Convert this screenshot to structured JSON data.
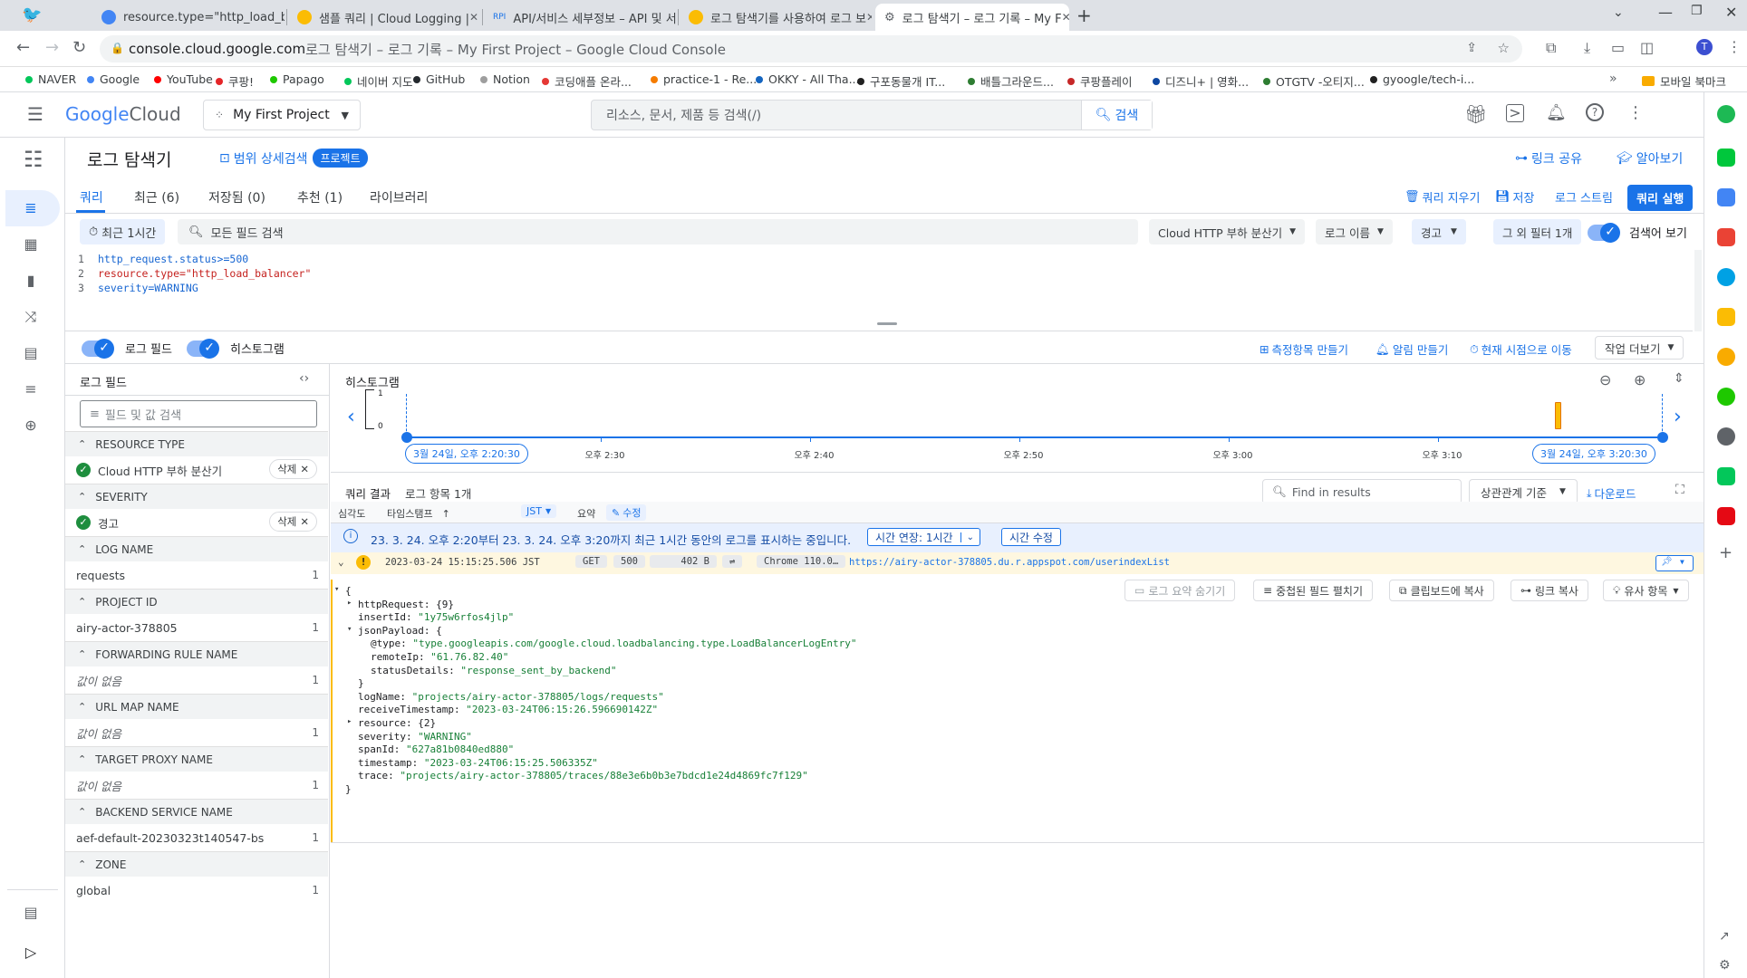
{
  "browser": {
    "tabs": [
      {
        "title": "resource.type=\"http_load_balan",
        "color": "#4285f4"
      },
      {
        "title": "샘플 쿼리 | Cloud Logging |",
        "color": "#fbbc04"
      },
      {
        "title": "API/서비스 세부정보 – API 및 서",
        "color": "#4285f4"
      },
      {
        "title": "로그 탐색기를 사용하여 로그 보",
        "color": "#fbbc04"
      },
      {
        "title": "로그 탐색기 – 로그 기록 – My F",
        "color": "#5f6368"
      }
    ],
    "url_domain": "console.cloud.google.com",
    "url_title": " 로그 탐색기 – 로그 기록 – My First Project – Google Cloud Console",
    "bookmarks": [
      {
        "label": "NAVER",
        "color": "#03c75a"
      },
      {
        "label": "Google",
        "color": "#4285f4"
      },
      {
        "label": "YouTube",
        "color": "#ff0000"
      },
      {
        "label": "쿠팡!",
        "color": "#e52528"
      },
      {
        "label": "Papago",
        "color": "#1ec800"
      },
      {
        "label": "네이버 지도",
        "color": "#03c75a"
      },
      {
        "label": "GitHub",
        "color": "#24292e"
      },
      {
        "label": "Notion",
        "color": "#9e9e9e"
      },
      {
        "label": "코딩애플 온라...",
        "color": "#e53935"
      },
      {
        "label": "practice-1 - Re...",
        "color": "#f57c00"
      },
      {
        "label": "OKKY - All Tha...",
        "color": "#1565c0"
      },
      {
        "label": "구포동물개 IT...",
        "color": "#212121"
      },
      {
        "label": "배틀그라운드...",
        "color": "#2e7d32"
      },
      {
        "label": "쿠팡플레이",
        "color": "#c62828"
      },
      {
        "label": "디즈니+ | 영화...",
        "color": "#0d47a1"
      },
      {
        "label": "OTGTV -오티지...",
        "color": "#2e7d32"
      },
      {
        "label": "gyoogle/tech-i...",
        "color": "#212121"
      }
    ],
    "bookmarks_more": "»",
    "mobile_bookmarks": "모바일 북마크"
  },
  "header": {
    "logo_google": "Google",
    "logo_cloud": " Cloud",
    "project": "My First Project",
    "search_placeholder": "리소스, 문서, 제품 등 검색(/)",
    "search_button": "검색"
  },
  "page": {
    "title": "로그 탐색기",
    "scope": "범위 상세검색",
    "scope_badge": "프로젝트",
    "share_link": "링크 공유",
    "learn": "알아보기"
  },
  "tabs": [
    {
      "label": "쿼리"
    },
    {
      "label": "최근 (6)"
    },
    {
      "label": "저장됨 (0)"
    },
    {
      "label": "추천 (1)"
    },
    {
      "label": "라이브러리"
    }
  ],
  "query_actions": {
    "clear": "쿼리 지우기",
    "save": "저장",
    "stream": "로그 스트림",
    "run": "쿼리 실행"
  },
  "filters": {
    "time": "최근 1시간",
    "search_all": "모든 필드 검색",
    "resource": "Cloud HTTP 부하 분산기",
    "log_name": "로그 이름",
    "severity": "경고",
    "more": "그 외 필터 1개",
    "show_query": "검색어 보기"
  },
  "query_lines": [
    {
      "num": "1",
      "text": "http_request.status>=500"
    },
    {
      "num": "2",
      "text": "resource.type=\"http_load_balancer\""
    },
    {
      "num": "3",
      "text": "severity=WARNING"
    }
  ],
  "toolbar2": {
    "log_fields": "로그 필드",
    "histogram": "히스토그램",
    "create_metric": "측정항목 만들기",
    "create_alert": "알림 만들기",
    "jump_now": "현재 시점으로 이동",
    "more_actions": "작업 더보기"
  },
  "fields_panel": {
    "title": "로그 필드",
    "search_placeholder": "필드 및 값 검색",
    "sections": [
      {
        "header": "RESOURCE TYPE",
        "value": "Cloud HTTP 부하 분산기",
        "selected": true,
        "remove": "삭제"
      },
      {
        "header": "SEVERITY",
        "value": "경고",
        "selected": true,
        "remove": "삭제"
      },
      {
        "header": "LOG NAME",
        "value": "requests",
        "count": "1"
      },
      {
        "header": "PROJECT ID",
        "value": "airy-actor-378805",
        "count": "1"
      },
      {
        "header": "FORWARDING RULE NAME",
        "value": "값이 없음",
        "count": "1",
        "italic": true
      },
      {
        "header": "URL MAP NAME",
        "value": "값이 없음",
        "count": "1",
        "italic": true
      },
      {
        "header": "TARGET PROXY NAME",
        "value": "값이 없음",
        "count": "1",
        "italic": true
      },
      {
        "header": "BACKEND SERVICE NAME",
        "value": "aef-default-20230323t140547-bs",
        "count": "1"
      },
      {
        "header": "ZONE",
        "value": "global",
        "count": "1"
      }
    ]
  },
  "histogram": {
    "title": "히스토그램",
    "y_max": "1",
    "y_min": "0",
    "start_label": "3월 24일, 오후 2:20:30",
    "end_label": "3월 24일, 오후 3:20:30",
    "ticks": [
      "오후 2:30",
      "오후 2:40",
      "오후 2:50",
      "오후 3:00",
      "오후 3:10"
    ],
    "bar_fraction": 0.915
  },
  "results": {
    "title": "쿼리 결과",
    "count": "로그 항목 1개",
    "find_placeholder": "Find in results",
    "relevance": "상관관계 기준",
    "download": "다운로드",
    "col_severity": "심각도",
    "col_timestamp": "타임스탬프",
    "col_tz": "JST",
    "col_summary": "요약",
    "col_edit": "수정",
    "info": "23. 3. 24. 오후 2:20부터 23. 3. 24. 오후 3:20까지 최근 1시간 동안의 로그를 표시하는 중입니다.",
    "extend": "시간 연장: 1시간",
    "edit_time": "시간 수정",
    "entry": {
      "timestamp": "2023-03-24 15:15:25.506 JST",
      "method": "GET",
      "status": "500",
      "size": "402 B",
      "agent": "Chrome 110.0…",
      "url": "https://airy-actor-378805.du.r.appspot.com/userindexList"
    },
    "entry_actions": {
      "hide_summary": "로그 요약 숨기기",
      "expand_nested": "중첩된 필드 펼치기",
      "copy_clipboard": "클립보드에 복사",
      "copy_link": "링크 복사",
      "similar": "유사 항목"
    },
    "json": [
      {
        "indent": 0,
        "toggle": "▾",
        "text": "{"
      },
      {
        "indent": 1,
        "toggle": "▸",
        "key": "httpRequest",
        "value": "{9}",
        "plain": true
      },
      {
        "indent": 1,
        "key": "insertId",
        "value": "\"1y75w6rfos4jlp\""
      },
      {
        "indent": 1,
        "toggle": "▾",
        "key": "jsonPayload",
        "value": "{",
        "plain": true
      },
      {
        "indent": 2,
        "key": "@type",
        "value": "\"type.googleapis.com/google.cloud.loadbalancing.type.LoadBalancerLogEntry\""
      },
      {
        "indent": 2,
        "key": "remoteIp",
        "value": "\"61.76.82.40\""
      },
      {
        "indent": 2,
        "key": "statusDetails",
        "value": "\"response_sent_by_backend\""
      },
      {
        "indent": 1,
        "text": "}"
      },
      {
        "indent": 1,
        "key": "logName",
        "value": "\"projects/airy-actor-378805/logs/requests\""
      },
      {
        "indent": 1,
        "key": "receiveTimestamp",
        "value": "\"2023-03-24T06:15:26.596690142Z\""
      },
      {
        "indent": 1,
        "toggle": "▸",
        "key": "resource",
        "value": "{2}",
        "plain": true
      },
      {
        "indent": 1,
        "key": "severity",
        "value": "\"WARNING\""
      },
      {
        "indent": 1,
        "key": "spanId",
        "value": "\"627a81b0840ed880\""
      },
      {
        "indent": 1,
        "key": "timestamp",
        "value": "\"2023-03-24T06:15:25.506335Z\""
      },
      {
        "indent": 1,
        "key": "trace",
        "value": "\"projects/airy-actor-378805/traces/88e3e6b0b3e7bdcd1e24d4869fc7f129\""
      },
      {
        "indent": 0,
        "text": "}"
      }
    ]
  },
  "colors": {
    "accent": "#1a73e8",
    "warning": "#fbbc04",
    "success": "#1e8e3e"
  }
}
